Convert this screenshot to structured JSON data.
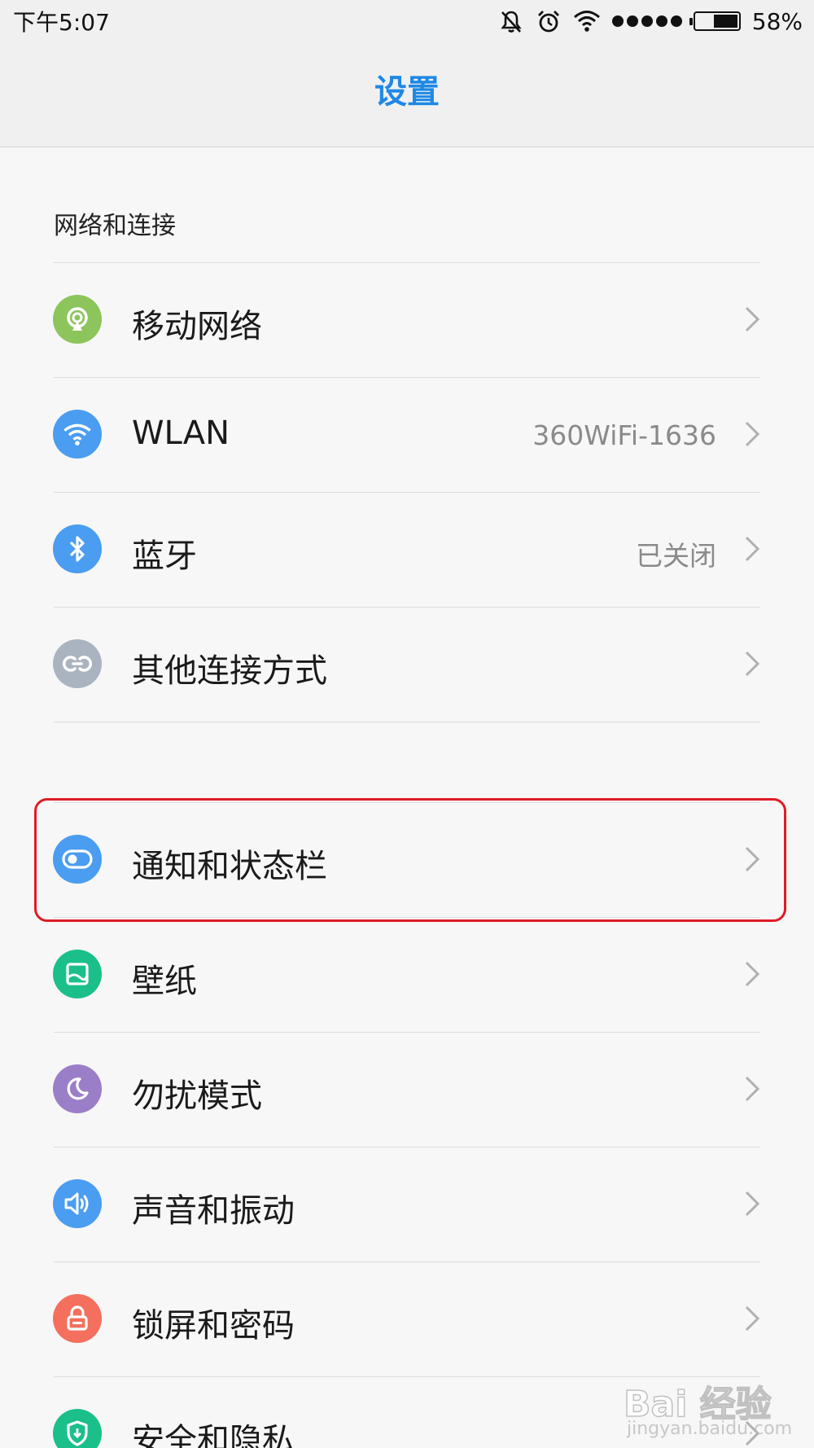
{
  "status_bar": {
    "time": "下午5:07",
    "battery_percent": "58%",
    "battery_level": 0.58,
    "icons": [
      "silent-icon",
      "alarm-icon",
      "wifi-icon",
      "signal-icon",
      "battery-icon"
    ]
  },
  "header": {
    "title": "设置"
  },
  "colors": {
    "accent": "#1e88e5",
    "highlight": "#e01b24",
    "mobile_network": "#8cc55b",
    "wlan": "#4a9df0",
    "bluetooth": "#4a9df0",
    "other_connections": "#aab4c0",
    "notifications": "#4a9df0",
    "wallpaper": "#1bbf8a",
    "do_not_disturb": "#9b7ec8",
    "sound": "#4a9df0",
    "lockscreen": "#f46f5d",
    "security": "#1bbf8a"
  },
  "section_network": {
    "header": "网络和连接",
    "items": [
      {
        "label": "移动网络",
        "value": "",
        "icon": "mobile-network-icon"
      },
      {
        "label": "WLAN",
        "value": "360WiFi-1636",
        "icon": "wifi-icon"
      },
      {
        "label": "蓝牙",
        "value": "已关闭",
        "icon": "bluetooth-icon"
      },
      {
        "label": "其他连接方式",
        "value": "",
        "icon": "link-icon"
      }
    ]
  },
  "section_personal": {
    "items": [
      {
        "label": "通知和状态栏",
        "value": "",
        "icon": "toggle-icon",
        "highlighted": true
      },
      {
        "label": "壁纸",
        "value": "",
        "icon": "wallpaper-icon"
      },
      {
        "label": "勿扰模式",
        "value": "",
        "icon": "moon-icon"
      },
      {
        "label": "声音和振动",
        "value": "",
        "icon": "speaker-icon"
      },
      {
        "label": "锁屏和密码",
        "value": "",
        "icon": "lock-icon"
      },
      {
        "label": "安全和隐私",
        "value": "",
        "icon": "shield-icon"
      }
    ]
  },
  "watermark": {
    "brand": "Bai 经验",
    "site": "jingyan.baidu.com"
  }
}
